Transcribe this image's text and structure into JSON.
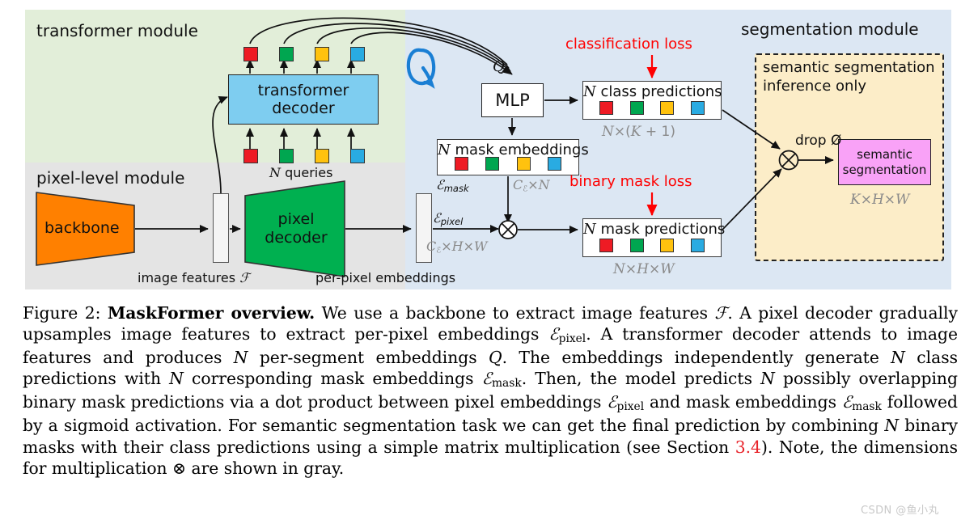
{
  "figure": {
    "modules": {
      "transformer_label": "transformer module",
      "pixel_label": "pixel-level module",
      "segmentation_label": "segmentation module"
    },
    "colors": {
      "transformer_bg": "#e2eed9",
      "pixel_bg": "#e4e4e4",
      "segmentation_bg": "#dce7f3",
      "inference_bg": "#fcedc8",
      "backbone": "#ff8000",
      "pixel_decoder": "#00b050",
      "transformer_decoder": "#7ecdf0",
      "semantic_segmentation": "#f9a2f7",
      "loss_red": "#ff0000",
      "dim_gray": "#8a8a8a",
      "annotation_blue": "#1a7fd4",
      "chip_red": "#ee1b24",
      "chip_green": "#00a650",
      "chip_yellow": "#ffc20e",
      "chip_blue": "#29abe2"
    },
    "boxes": {
      "backbone": "backbone",
      "pixel_decoder_line1": "pixel",
      "pixel_decoder_line2": "decoder",
      "transformer_decoder_line1": "transformer",
      "transformer_decoder_line2": "decoder",
      "mlp": "MLP",
      "semantic_segmentation_line1": "semantic",
      "semantic_segmentation_line2": "segmentation",
      "class_predictions": "N class predictions",
      "mask_embeddings": "N mask embeddings",
      "mask_predictions": "N mask predictions",
      "inference_line1": "semantic segmentation",
      "inference_line2": "inference only"
    },
    "labels": {
      "n_queries": "N queries",
      "image_features": "image features ℱ",
      "per_pixel_embeddings": "per-pixel embeddings",
      "e_mask": "ℰmask",
      "e_pixel": "ℰpixel",
      "q_symbol": "Q",
      "q_annotation": "Q",
      "drop_null": "drop Ø",
      "classification_loss": "classification loss",
      "binary_mask_loss": "binary mask loss"
    },
    "dims": {
      "class_predictions": "N×(K + 1)",
      "mask_predictions": "N×H×W",
      "semantic_segmentation": "K×H×W",
      "mask_embeddings": "Cℰ×N",
      "pixel_embeddings": "Cℰ×H×W"
    },
    "chip_colors": [
      "#ee1b24",
      "#00a650",
      "#ffc20e",
      "#29abe2"
    ]
  },
  "caption": {
    "figure_number": "Figure 2:",
    "title": "MaskFormer overview.",
    "section_reference": "3.4",
    "full_text": "Figure 2: MaskFormer overview. We use a backbone to extract image features F. A pixel decoder gradually upsamples image features to extract per-pixel embeddings Epixel. A transformer decoder attends to image features and produces N per-segment embeddings Q. The embeddings independently generate N class predictions with N corresponding mask embeddings Emask. Then, the model predicts N possibly overlapping binary mask predictions via a dot product between pixel embeddings Epixel and mask embeddings Emask followed by a sigmoid activation. For semantic segmentation task we can get the final prediction by combining N binary masks with their class predictions using a simple matrix multiplication (see Section 3.4). Note, the dimensions for multiplication ⊗ are shown in gray."
  },
  "watermark": "CSDN @鱼小丸"
}
